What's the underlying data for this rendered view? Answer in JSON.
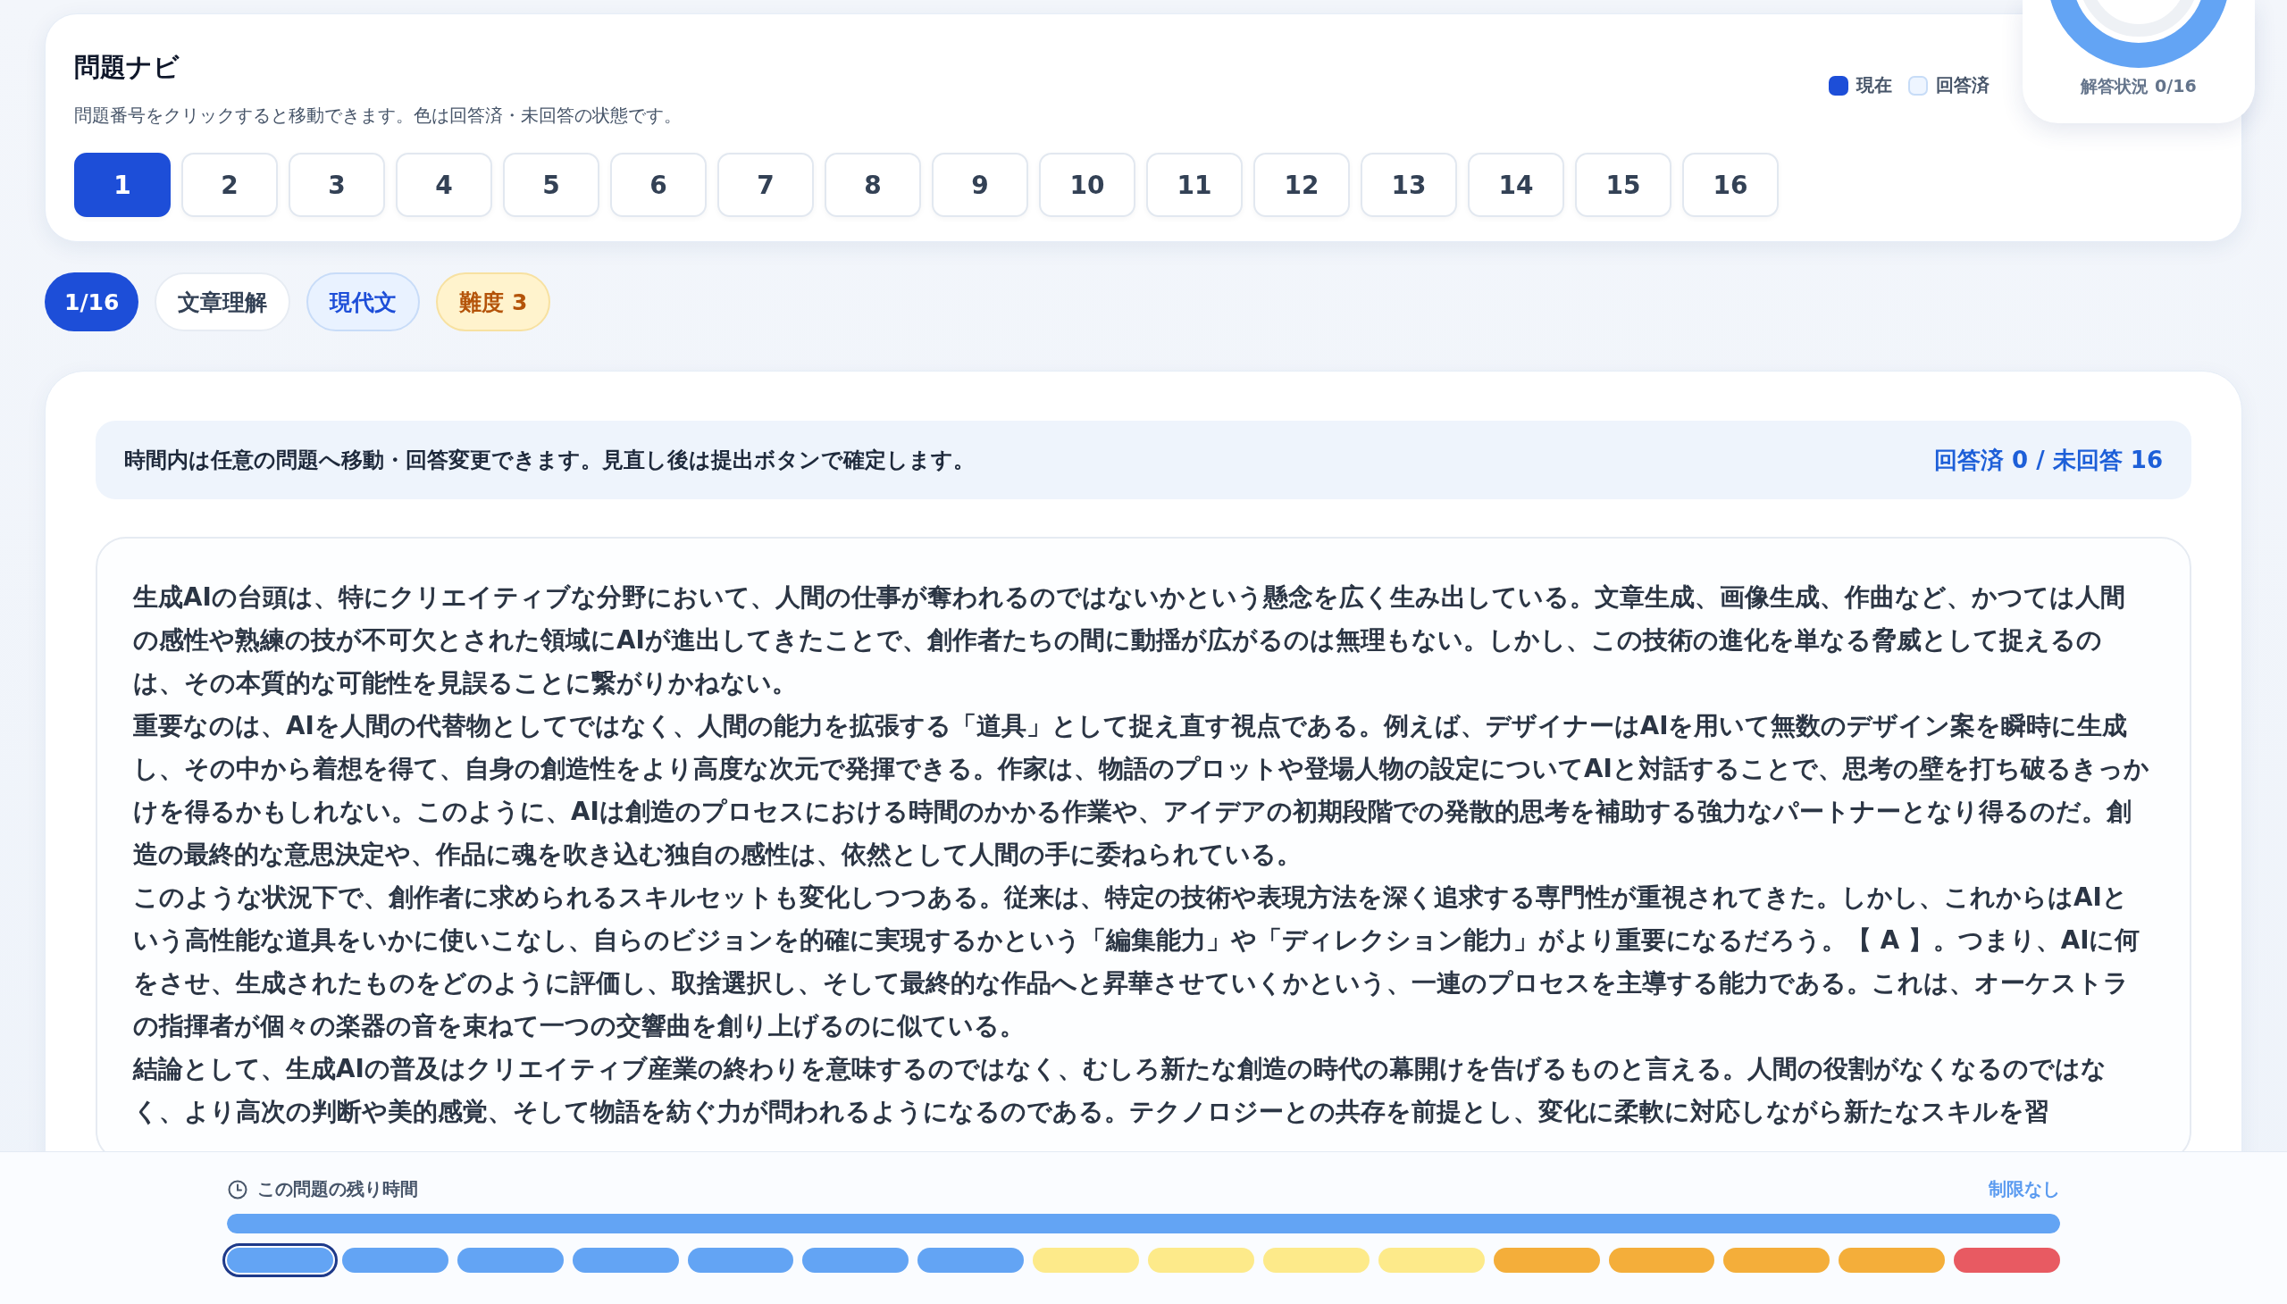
{
  "nav": {
    "title": "問題ナビ",
    "subtitle": "問題番号をクリックすると移動できます。色は回答済・未回答の状態です。",
    "legend": [
      {
        "label": "現在",
        "kind": "current"
      },
      {
        "label": "回答済",
        "kind": "answered"
      }
    ],
    "questions": [
      {
        "label": "1",
        "selected": true
      },
      {
        "label": "2",
        "selected": false
      },
      {
        "label": "3",
        "selected": false
      },
      {
        "label": "4",
        "selected": false
      },
      {
        "label": "5",
        "selected": false
      },
      {
        "label": "6",
        "selected": false
      },
      {
        "label": "7",
        "selected": false
      },
      {
        "label": "8",
        "selected": false
      },
      {
        "label": "9",
        "selected": false
      },
      {
        "label": "10",
        "selected": false
      },
      {
        "label": "11",
        "selected": false
      },
      {
        "label": "12",
        "selected": false
      },
      {
        "label": "13",
        "selected": false
      },
      {
        "label": "14",
        "selected": false
      },
      {
        "label": "15",
        "selected": false
      },
      {
        "label": "16",
        "selected": false
      }
    ]
  },
  "progress_card": {
    "label": "解答状況 0/16"
  },
  "tags": [
    {
      "label": "1/16",
      "kind": "count"
    },
    {
      "label": "文章理解",
      "kind": "plain"
    },
    {
      "label": "現代文",
      "kind": "genre"
    },
    {
      "label": "難度 3",
      "kind": "level"
    }
  ],
  "notice": {
    "text": "時間内は任意の問題へ移動・回答変更できます。見直し後は提出ボタンで確定します。",
    "status": "回答済 0 / 未回答 16"
  },
  "passage": [
    "生成AIの台頭は、特にクリエイティブな分野において、人間の仕事が奪われるのではないかという懸念を広く生み出している。文章生成、画像生成、作曲など、かつては人間の感性や熟練の技が不可欠とされた領域にAIが進出してきたことで、創作者たちの間に動揺が広がるのは無理もない。しかし、この技術の進化を単なる脅威として捉えるのは、その本質的な可能性を見誤ることに繋がりかねない。",
    "重要なのは、AIを人間の代替物としてではなく、人間の能力を拡張する「道具」として捉え直す視点である。例えば、デザイナーはAIを用いて無数のデザイン案を瞬時に生成し、その中から着想を得て、自身の創造性をより高度な次元で発揮できる。作家は、物語のプロットや登場人物の設定についてAIと対話することで、思考の壁を打ち破るきっかけを得るかもしれない。このように、AIは創造のプロセスにおける時間のかかる作業や、アイデアの初期段階での発散的思考を補助する強力なパートナーとなり得るのだ。創造の最終的な意思決定や、作品に魂を吹き込む独自の感性は、依然として人間の手に委ねられている。",
    "このような状況下で、創作者に求められるスキルセットも変化しつつある。従来は、特定の技術や表現方法を深く追求する専門性が重視されてきた。しかし、これからはAIという高性能な道具をいかに使いこなし、自らのビジョンを的確に実現するかという「編集能力」や「ディレクション能力」がより重要になるだろう。【 A 】。つまり、AIに何をさせ、生成されたものをどのように評価し、取捨選択し、そして最終的な作品へと昇華させていくかという、一連のプロセスを主導する能力である。これは、オーケストラの指揮者が個々の楽器の音を束ねて一つの交響曲を創り上げるのに似ている。",
    "結論として、生成AIの普及はクリエイティブ産業の終わりを意味するのではなく、むしろ新たな創造の時代の幕開けを告げるものと言える。人間の役割がなくなるのではなく、より高次の判断や美的感覚、そして物語を紡ぐ力が問われるようになるのである。テクノロジーとの共存を前提とし、変化に柔軟に対応しながら新たなスキルを習"
  ],
  "timer": {
    "label": "この問題の残り時間",
    "value": "制限なし",
    "level": 1,
    "segments": [
      {
        "color": "#63a4f4",
        "selected": true
      },
      {
        "color": "#63a4f4",
        "selected": false
      },
      {
        "color": "#63a4f4",
        "selected": false
      },
      {
        "color": "#63a4f4",
        "selected": false
      },
      {
        "color": "#63a4f4",
        "selected": false
      },
      {
        "color": "#63a4f4",
        "selected": false
      },
      {
        "color": "#63a4f4",
        "selected": false
      },
      {
        "color": "#fdea8a",
        "selected": false
      },
      {
        "color": "#fdea8a",
        "selected": false
      },
      {
        "color": "#fdea8a",
        "selected": false
      },
      {
        "color": "#fdea8a",
        "selected": false
      },
      {
        "color": "#f4ae3a",
        "selected": false
      },
      {
        "color": "#f4ae3a",
        "selected": false
      },
      {
        "color": "#f4ae3a",
        "selected": false
      },
      {
        "color": "#f4ae3a",
        "selected": false
      },
      {
        "color": "#e85a62",
        "selected": false
      }
    ]
  }
}
